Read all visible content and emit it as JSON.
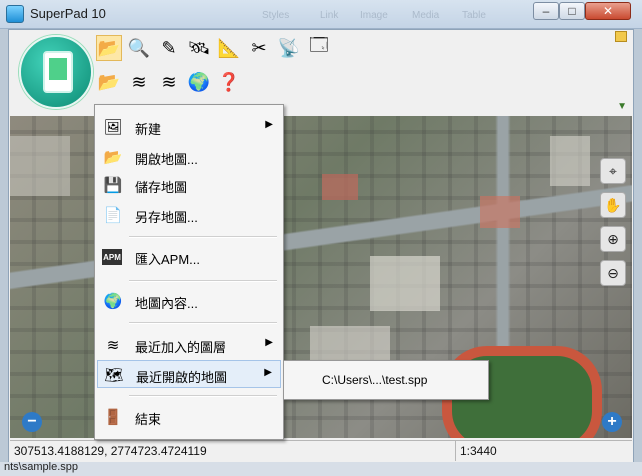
{
  "window": {
    "title": "SuperPad 10",
    "min_glyph": "–",
    "max_glyph": "□",
    "close_glyph": "✕",
    "ghost_labels": [
      "Styles",
      "Link",
      "Image",
      "Media",
      "Table"
    ]
  },
  "toolbar_icons": {
    "row1": [
      "folder-open-icon",
      "search-icon",
      "edit-pen-icon",
      "satellite-icon",
      "measure-icon",
      "tools-icon",
      "gps-tower-icon",
      "layers-window-icon"
    ],
    "row2": [
      "open-map-icon",
      "add-layers-icon",
      "layers-refresh-icon",
      "globe-map-icon",
      "help-icon"
    ]
  },
  "menu": {
    "items": [
      {
        "label": "新建",
        "has_submenu": true
      },
      {
        "label": "開啟地圖...",
        "has_submenu": false
      },
      {
        "label": "儲存地圖",
        "has_submenu": false
      },
      {
        "label": "另存地圖...",
        "has_submenu": false
      },
      {
        "label": "匯入APM...",
        "has_submenu": false
      },
      {
        "label": "地圖內容...",
        "has_submenu": false
      },
      {
        "label": "最近加入的圖層",
        "has_submenu": true
      },
      {
        "label": "最近開啟的地圖",
        "has_submenu": true,
        "highlighted": true
      },
      {
        "label": "結束",
        "has_submenu": false
      }
    ],
    "apm_icon_text": "APM"
  },
  "submenu": {
    "recent_maps": [
      "C:\\Users\\...\\test.spp"
    ]
  },
  "map_controls": [
    "locate-icon",
    "pan-hand-icon",
    "zoom-in-icon",
    "zoom-out-icon"
  ],
  "zoom": {
    "minus": "−",
    "plus": "+"
  },
  "status": {
    "coordinates": "307513.4188129, 2774723.4724119",
    "scale": "1:3440"
  },
  "bottom_text": "nts\\sample.spp"
}
